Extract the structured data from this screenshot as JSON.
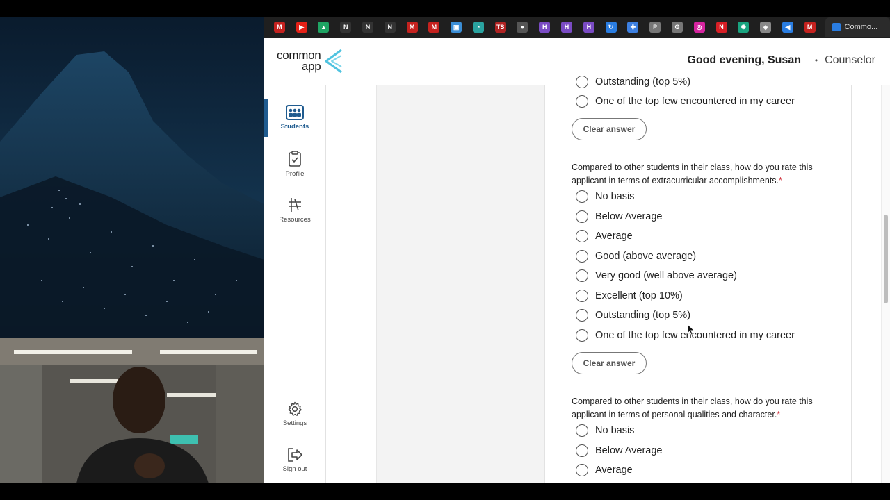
{
  "tabbar": {
    "favicons": [
      {
        "name": "gmail-icon",
        "label": "M",
        "color": "#c5221f"
      },
      {
        "name": "youtube-icon",
        "label": "▶",
        "color": "#e62117"
      },
      {
        "name": "drive-icon",
        "label": "▲",
        "color": "#1fa463"
      },
      {
        "name": "notion-icon",
        "label": "N",
        "color": "#333333"
      },
      {
        "name": "notion-icon",
        "label": "N",
        "color": "#333333"
      },
      {
        "name": "notion-icon",
        "label": "N",
        "color": "#333333"
      },
      {
        "name": "gmail-icon",
        "label": "M",
        "color": "#c5221f"
      },
      {
        "name": "gmail-icon",
        "label": "M",
        "color": "#c5221f"
      },
      {
        "name": "video-icon",
        "label": "▣",
        "color": "#3b8ed6"
      },
      {
        "name": "app-icon",
        "label": "◔",
        "color": "#2aa3a0"
      },
      {
        "name": "ts-icon",
        "label": "TS",
        "color": "#b02323"
      },
      {
        "name": "github-icon",
        "label": "●",
        "color": "#555555"
      },
      {
        "name": "h-icon",
        "label": "H",
        "color": "#7a4bc4"
      },
      {
        "name": "h-icon",
        "label": "H",
        "color": "#7a4bc4"
      },
      {
        "name": "h-icon",
        "label": "H",
        "color": "#7a4bc4"
      },
      {
        "name": "refresh-icon",
        "label": "↻",
        "color": "#2a7de1"
      },
      {
        "name": "plus-icon",
        "label": "✚",
        "color": "#3c7fe0"
      },
      {
        "name": "p-icon",
        "label": "P",
        "color": "#777777"
      },
      {
        "name": "g-icon",
        "label": "G",
        "color": "#777777"
      },
      {
        "name": "instagram-icon",
        "label": "◎",
        "color": "#d6249f"
      },
      {
        "name": "netflix-icon",
        "label": "N",
        "color": "#d81f26"
      },
      {
        "name": "chatgpt-icon",
        "label": "✺",
        "color": "#19a37f"
      },
      {
        "name": "shield-icon",
        "label": "◈",
        "color": "#888888"
      },
      {
        "name": "commonapp-icon",
        "label": "◀",
        "color": "#2a7de1"
      },
      {
        "name": "gmail-icon",
        "label": "M",
        "color": "#c5221f"
      }
    ],
    "active_tab": "Commo..."
  },
  "header": {
    "logo_line1": "common",
    "logo_line2": "app",
    "greeting": "Good evening, Susan",
    "role": "Counselor"
  },
  "nav": {
    "students": "Students",
    "profile": "Profile",
    "resources": "Resources",
    "settings": "Settings",
    "signout": "Sign out"
  },
  "form": {
    "partial_option": "Outstanding (top 5%)",
    "top_option": "One of the top few encountered in my career",
    "clear_label": "Clear answer",
    "q_extracurricular": "Compared to other students in their class, how do you rate this applicant in terms of extracurricular accomplishments.",
    "q_personal": "Compared to other students in their class, how do you rate this applicant in terms of personal qualities and character.",
    "required_mark": "*",
    "options": [
      "No basis",
      "Below Average",
      "Average",
      "Good (above average)",
      "Very good (well above average)",
      "Excellent (top 10%)",
      "Outstanding (top 5%)",
      "One of the top few encountered in my career"
    ]
  }
}
